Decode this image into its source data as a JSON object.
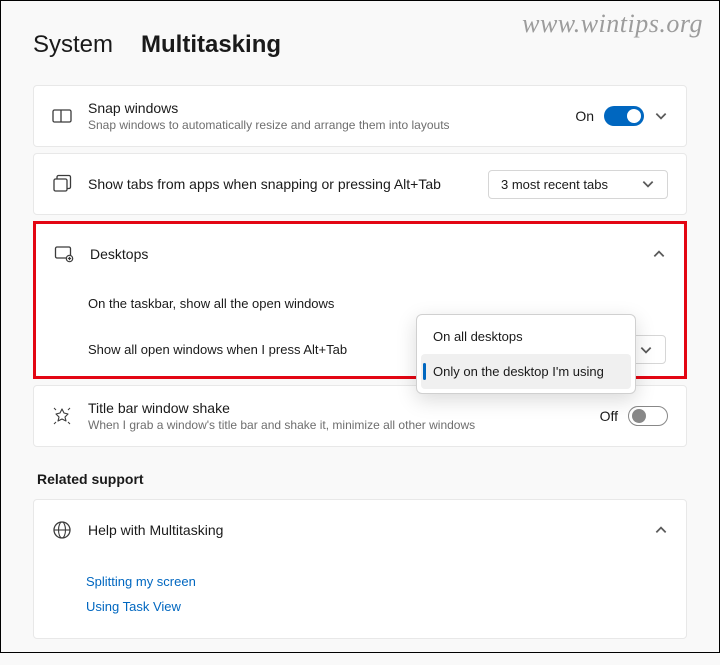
{
  "watermark": "www.wintips.org",
  "breadcrumb": {
    "parent": "System",
    "current": "Multitasking"
  },
  "snap": {
    "title": "Snap windows",
    "desc": "Snap windows to automatically resize and arrange them into layouts",
    "state": "On",
    "toggle": true
  },
  "tabs": {
    "title": "Show tabs from apps when snapping or pressing Alt+Tab",
    "selected": "3 most recent tabs"
  },
  "desktops": {
    "title": "Desktops",
    "sub1": {
      "label": "On the taskbar, show all the open windows"
    },
    "sub2": {
      "label": "Show all open windows when I press Alt+Tab",
      "selected": "Only on the desktop I'm using"
    },
    "dropdown": {
      "opt1": "On all desktops",
      "opt2": "Only on the desktop I'm using"
    }
  },
  "shake": {
    "title": "Title bar window shake",
    "desc": "When I grab a window's title bar and shake it, minimize all other windows",
    "state": "Off",
    "toggle": false
  },
  "related": {
    "heading": "Related support",
    "help_title": "Help with Multitasking",
    "link1": "Splitting my screen",
    "link2": "Using Task View"
  }
}
